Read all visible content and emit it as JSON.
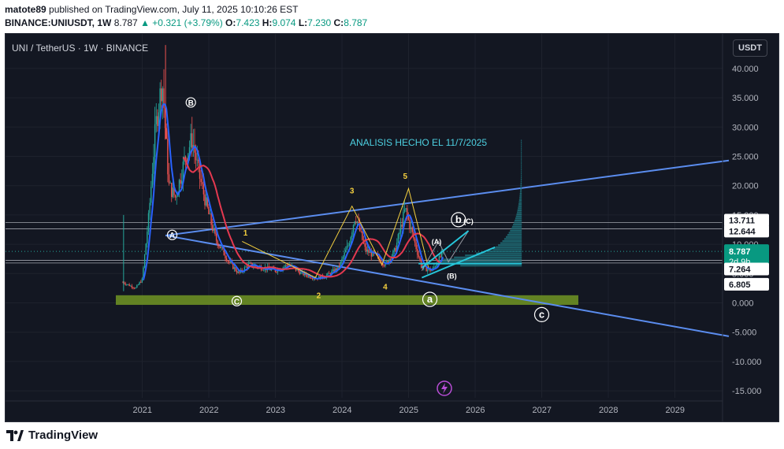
{
  "header": {
    "user": "matote89",
    "published_text": "published on TradingView.com, July 11, 2025 10:10:26 EST",
    "symbol": "BINANCE:UNIUSDT",
    "interval": "1W",
    "last": "8.787",
    "change": "+0.321 (+3.79%)",
    "o_label": "O:",
    "o": "7.423",
    "h_label": "H:",
    "h": "9.074",
    "l_label": "L:",
    "l": "7.230",
    "c_label": "C:",
    "c": "8.787"
  },
  "chart_title": "UNI / TetherUS · 1W · BINANCE",
  "currency_button": "USDT",
  "annotation_text": "ANALISIS HECHO EL 11/7/2025",
  "footer": {
    "brand": "TradingView"
  },
  "price_badges": {
    "last_price": "8.787",
    "countdown": "2d 9h",
    "levels": [
      "13.711",
      "12.644",
      "7.264",
      "6.805"
    ]
  },
  "wave_labels": {
    "circled": [
      "A",
      "B",
      "C",
      "a",
      "b",
      "c"
    ],
    "numbers": [
      "1",
      "2",
      "3",
      "4",
      "5"
    ],
    "parenthesized": [
      "(A)",
      "(B)",
      "(C)"
    ]
  },
  "colors": {
    "background": "#131722",
    "trendline": "#5b8def",
    "ema": "#e53950",
    "sma": "#2962ff",
    "up_candle": "#26a69a",
    "down_candle": "#ef5350",
    "zone": "#6b8e23",
    "annotation": "#4dd0e1",
    "wave_numbers": "#f5d03f"
  },
  "chart_data": {
    "type": "candlestick",
    "title": "UNI / TetherUS · 1W · BINANCE",
    "y_axis": {
      "ticks": [
        "40.000",
        "35.000",
        "30.000",
        "25.000",
        "20.000",
        "15.000",
        "10.000",
        "5.000",
        "0.000",
        "-5.000",
        "-10.000",
        "-15.000"
      ],
      "ylim": [
        -18,
        44
      ]
    },
    "x_axis": {
      "ticks": [
        "2021",
        "2022",
        "2023",
        "2024",
        "2025",
        "2026",
        "2027",
        "2028",
        "2029"
      ]
    },
    "price_path": [
      [
        2020.71,
        3.5
      ],
      [
        2020.9,
        2.5
      ],
      [
        2021.0,
        4.0
      ],
      [
        2021.1,
        15.0
      ],
      [
        2021.2,
        30.0
      ],
      [
        2021.3,
        38.0
      ],
      [
        2021.4,
        20.0
      ],
      [
        2021.5,
        18.0
      ],
      [
        2021.65,
        25.0
      ],
      [
        2021.75,
        28.0
      ],
      [
        2021.85,
        22.0
      ],
      [
        2022.0,
        15.0
      ],
      [
        2022.1,
        11.0
      ],
      [
        2022.3,
        7.0
      ],
      [
        2022.45,
        5.0
      ],
      [
        2022.6,
        6.5
      ],
      [
        2022.8,
        6.0
      ],
      [
        2023.0,
        5.5
      ],
      [
        2023.2,
        6.5
      ],
      [
        2023.4,
        5.0
      ],
      [
        2023.6,
        4.2
      ],
      [
        2023.75,
        4.5
      ],
      [
        2023.95,
        6.0
      ],
      [
        2024.1,
        10.0
      ],
      [
        2024.2,
        15.0
      ],
      [
        2024.35,
        9.0
      ],
      [
        2024.5,
        8.0
      ],
      [
        2024.65,
        6.5
      ],
      [
        2024.8,
        9.0
      ],
      [
        2024.95,
        16.0
      ],
      [
        2025.05,
        12.0
      ],
      [
        2025.2,
        6.0
      ],
      [
        2025.35,
        5.5
      ],
      [
        2025.45,
        7.3
      ],
      [
        2025.53,
        8.787
      ]
    ],
    "indicators": [
      "EMA (red)",
      "SMA (blue)"
    ],
    "volume_profile": true
  }
}
